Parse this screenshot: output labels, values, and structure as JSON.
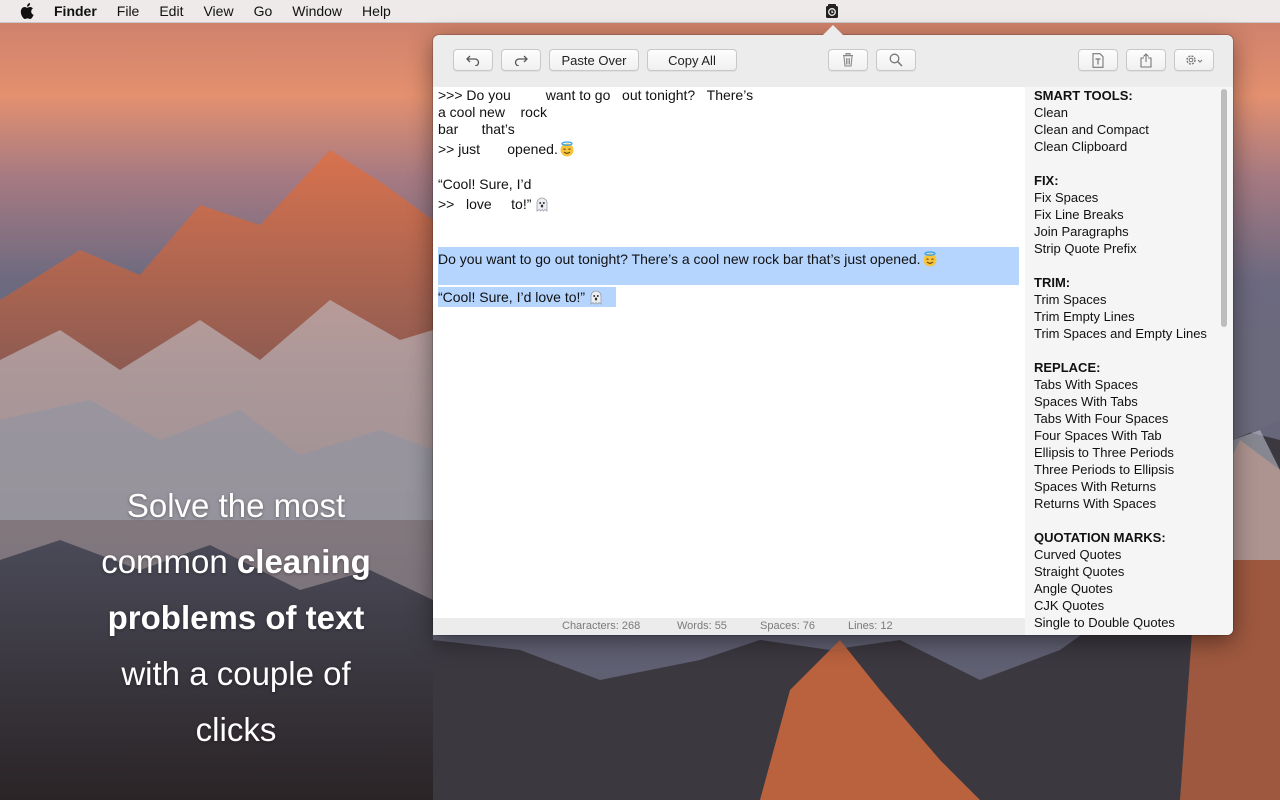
{
  "menubar": {
    "app_name": "Finder",
    "items": [
      "File",
      "Edit",
      "View",
      "Go",
      "Window",
      "Help"
    ]
  },
  "toolbar": {
    "paste_over_label": "Paste Over",
    "copy_all_label": "Copy All",
    "icons": [
      "undo-icon",
      "redo-icon",
      "trash-icon",
      "search-icon",
      "text-file-icon",
      "share-icon",
      "gear-icon"
    ]
  },
  "editor": {
    "lines": [
      ">>> Do you         want to go   out tonight?   There’s",
      "a cool new    rock",
      "bar      that’s",
      ">> just       opened.",
      "“Cool! Sure, I’d",
      ">>   love     to!”",
      "Do you want to go out tonight? There’s a cool new rock bar that’s just opened.",
      "“Cool! Sure, I’d love to!”"
    ]
  },
  "status": {
    "characters": "Characters: 268",
    "words": "Words: 55",
    "spaces": "Spaces: 76",
    "lines": "Lines: 12"
  },
  "tools": {
    "smart_title": "SMART TOOLS:",
    "smart": [
      "Clean",
      "Clean and Compact",
      "Clean Clipboard"
    ],
    "fix_title": "FIX:",
    "fix": [
      "Fix Spaces",
      "Fix Line Breaks",
      "Join Paragraphs",
      "Strip Quote Prefix"
    ],
    "trim_title": "TRIM:",
    "trim": [
      "Trim Spaces",
      "Trim Empty Lines",
      "Trim Spaces and Empty Lines"
    ],
    "replace_title": "REPLACE:",
    "replace": [
      "Tabs With Spaces",
      "Spaces With Tabs",
      "Tabs With Four Spaces",
      "Four Spaces With Tab",
      "Ellipsis to Three Periods",
      "Three Periods to Ellipsis",
      "Spaces With Returns",
      "Returns With Spaces"
    ],
    "quotes_title": "QUOTATION MARKS:",
    "quotes": [
      "Curved Quotes",
      "Straight Quotes",
      "Angle Quotes",
      "CJK Quotes",
      "Single to Double Quotes"
    ]
  },
  "promo": {
    "line1": "Solve the most",
    "line2_plain": "common ",
    "line2_bold": "cleaning",
    "line3_bold": "problems of text",
    "line4": "with a couple of",
    "line5": "clicks"
  },
  "colors": {
    "selection": "#b5d5ff",
    "window_bg": "#ececec",
    "tools_bg": "#f5f5f5"
  }
}
